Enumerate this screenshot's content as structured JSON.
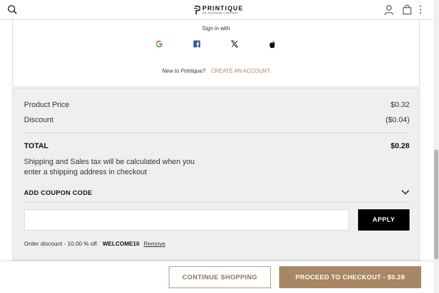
{
  "header": {
    "logo_word": "PRINTIQUE",
    "logo_sub": "AN ADORAMA COMPANY"
  },
  "signin": {
    "sign_in_with": "Sign in with",
    "providers": [
      "google-icon",
      "facebook-icon",
      "x-icon",
      "apple-icon"
    ],
    "new_to": "New to Printique?",
    "create_account": "CREATE AN ACCOUNT"
  },
  "summary": {
    "product_price_label": "Product Price",
    "product_price_value": "$0.32",
    "discount_label": "Discount",
    "discount_value": "($0.04)",
    "total_label": "TOTAL",
    "total_value": "$0.28",
    "tax_note": "Shipping and Sales tax will be calculated when you enter a shipping address in checkout"
  },
  "coupon": {
    "heading": "ADD COUPON CODE",
    "input_value": "",
    "apply_label": "APPLY",
    "order_discount_text": "Order discount - 10.00 % off.",
    "code": "WELCOME10",
    "remove_label": "Remove"
  },
  "footer": {
    "continue_label": "CONTINUE SHOPPING",
    "checkout_label": "PROCEED TO CHECKOUT - $0.28"
  },
  "colors": {
    "accent": "#a88764",
    "summary_bg": "#efefef",
    "apply_bg": "#000000"
  }
}
